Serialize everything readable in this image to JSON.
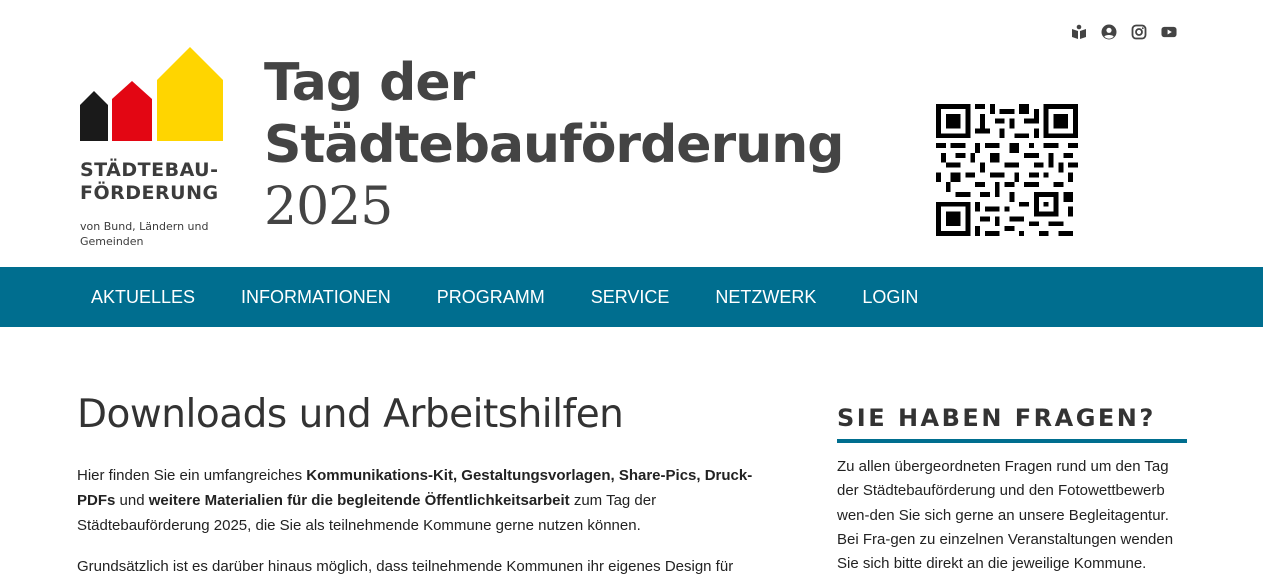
{
  "header": {
    "logo": {
      "word_line1": "STÄDTEBAU-",
      "word_line2": "FÖRDERUNG",
      "subtitle": "von Bund, Ländern und Gemeinden",
      "colors": {
        "black": "#1a1a1a",
        "red": "#e30613",
        "gold": "#ffd500"
      }
    },
    "title_line1": "Tag der",
    "title_line2": "Städtebauförderung",
    "title_year": "2025",
    "social_icons": [
      "map-book-icon",
      "user-account-icon",
      "instagram-icon",
      "youtube-icon"
    ]
  },
  "nav": {
    "items": [
      {
        "label": "AKTUELLES"
      },
      {
        "label": "INFORMATIONEN"
      },
      {
        "label": "PROGRAMM"
      },
      {
        "label": "SERVICE"
      },
      {
        "label": "NETZWERK"
      },
      {
        "label": "LOGIN"
      }
    ],
    "background": "#006e8f"
  },
  "main": {
    "title": "Downloads und Arbeitshilfen",
    "p1_a": "Hier finden Sie ein umfangreiches ",
    "p1_b": "Kommunikations-Kit, Gestaltungsvorlagen, Share-Pics, Druck-PDFs",
    "p1_c": " und ",
    "p1_d": "weitere Materialien für die begleitende Öffentlichkeitsarbeit",
    "p1_e": " zum Tag der Städtebauförderung 2025, die Sie als teilnehmende Kommune gerne nutzen können.",
    "p2": "Grundsätzlich ist es darüber hinaus möglich, dass teilnehmende Kommunen ihr eigenes Design für"
  },
  "sidebar": {
    "title": "SIE HABEN FRAGEN?",
    "text": "Zu allen übergeordneten Fragen rund um den Tag der Städtebauförderung und den Fotowettbewerb wen-den Sie sich gerne an unsere Begleitagentur. Bei Fra-gen zu einzelnen Veranstaltungen wenden Sie sich bitte direkt an die jeweilige Kommune."
  }
}
